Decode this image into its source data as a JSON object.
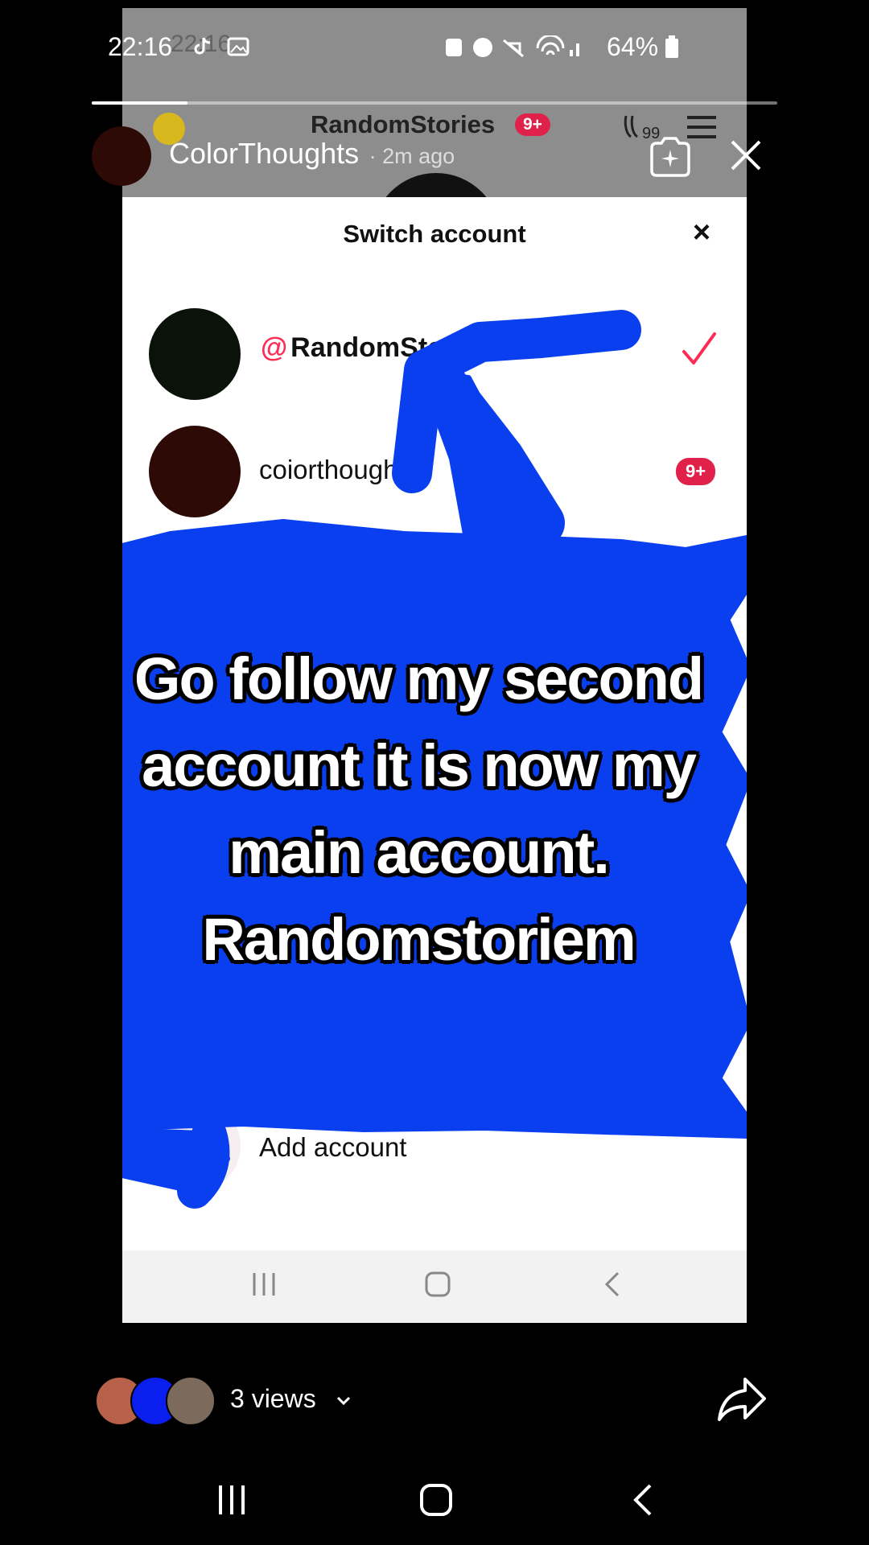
{
  "inner_screenshot": {
    "status_bar": {
      "time": "22:16",
      "battery": "64%"
    },
    "app_bar": {
      "username": "RandomStories",
      "badge": "9+",
      "points": "99"
    },
    "sheet": {
      "title": "Switch account",
      "accounts": [
        {
          "at": "@",
          "name": "RandomStories",
          "selected": true
        },
        {
          "name": "coiorthoughts",
          "badge": "9+"
        }
      ],
      "add_account_label": "Add account"
    }
  },
  "story": {
    "username": "ColorThoughts",
    "time_ago": "· 2m ago",
    "progress": 0.14,
    "caption_lines": [
      "Go follow my second",
      "account it is now my",
      "main account.",
      "Randomstoriem"
    ],
    "views_label": "3 views"
  },
  "colors": {
    "accent": "#fe2c55",
    "scribble": "#0a3ff0",
    "dark_red": "#2d0a05"
  }
}
